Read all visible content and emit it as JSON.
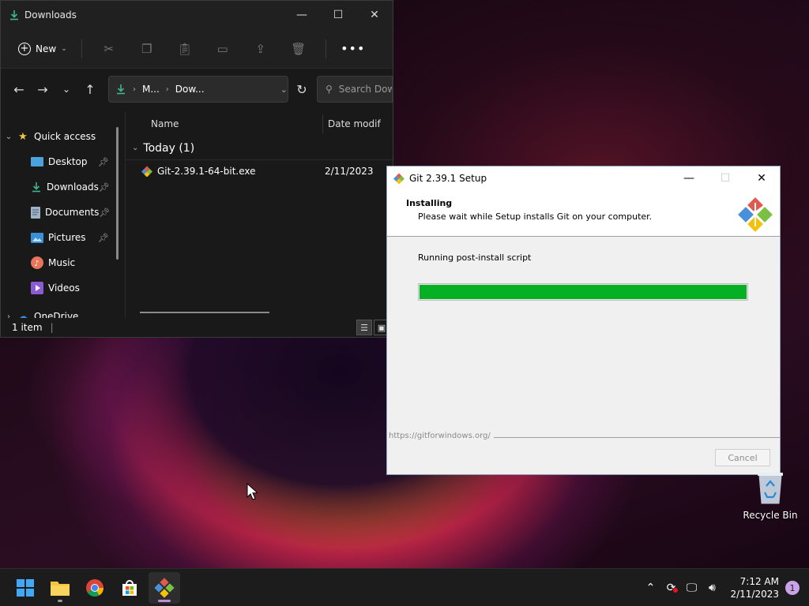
{
  "explorer": {
    "title": "Downloads",
    "toolbar": {
      "new_label": "New"
    },
    "address": {
      "segments": [
        "M...",
        "Dow..."
      ]
    },
    "search": {
      "placeholder": "Search Downloa"
    },
    "sidebar": {
      "items": [
        {
          "label": "Quick access",
          "icon": "star-icon"
        },
        {
          "label": "Desktop",
          "icon": "desktop-icon",
          "pinned": true
        },
        {
          "label": "Downloads",
          "icon": "download-icon",
          "pinned": true
        },
        {
          "label": "Documents",
          "icon": "document-icon",
          "pinned": true
        },
        {
          "label": "Pictures",
          "icon": "pictures-icon",
          "pinned": true
        },
        {
          "label": "Music",
          "icon": "music-icon"
        },
        {
          "label": "Videos",
          "icon": "videos-icon"
        },
        {
          "label": "OneDrive",
          "icon": "cloud-icon"
        }
      ]
    },
    "columns": {
      "name": "Name",
      "date": "Date modif"
    },
    "group": {
      "label": "Today (1)"
    },
    "files": [
      {
        "name": "Git-2.39.1-64-bit.exe",
        "date": "2/11/2023"
      }
    ],
    "status": {
      "item_count": "1 item"
    }
  },
  "setup": {
    "title": "Git 2.39.1 Setup",
    "header_title": "Installing",
    "header_subtitle": "Please wait while Setup installs Git on your computer.",
    "status_text": "Running post-install script",
    "progress_percent": 100,
    "url": "https://gitforwindows.org/",
    "cancel_label": "Cancel"
  },
  "desktop": {
    "recycle_bin_label": "Recycle Bin"
  },
  "taskbar": {
    "apps": [
      "start-icon",
      "file-explorer-icon",
      "chrome-icon",
      "store-icon",
      "git-setup-icon"
    ],
    "time": "7:12 AM",
    "date": "2/11/2023",
    "notification_count": "1"
  },
  "colors": {
    "progress_fill": "#06b025",
    "accent": "#c48ae0"
  }
}
